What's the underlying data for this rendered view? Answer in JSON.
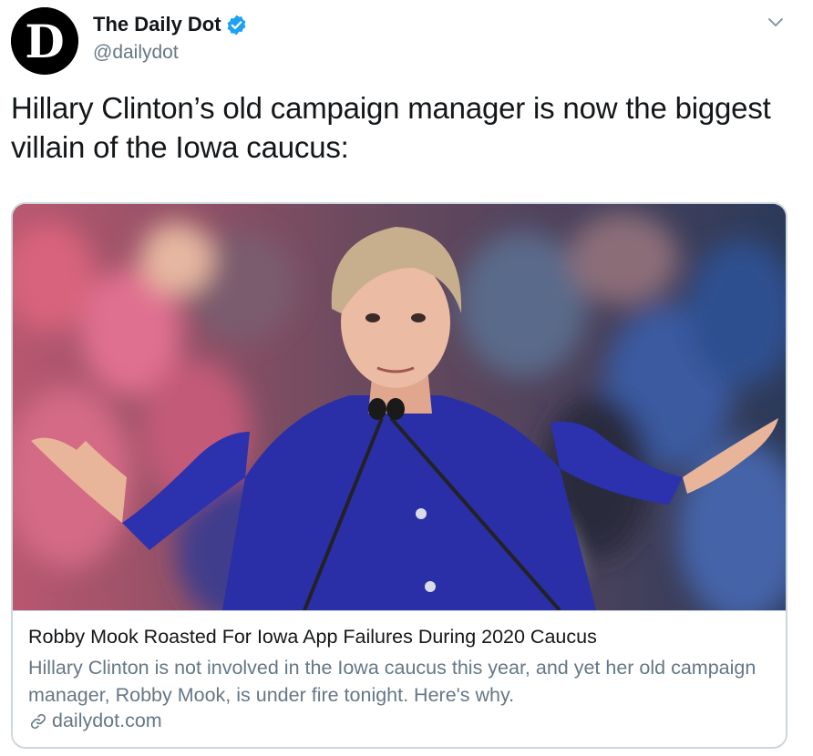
{
  "author": {
    "display_name": "The Daily Dot",
    "handle": "@dailydot",
    "avatar_letter": "D",
    "verified": true,
    "verified_color": "#1da1f2"
  },
  "tweet": {
    "text": "Hillary Clinton’s old campaign manager is now the biggest villain of the Iowa caucus:"
  },
  "card": {
    "image_icon": "photo-woman-at-podium",
    "title": "Robby Mook Roasted For Iowa App Failures During 2020 Caucus",
    "description": "Hillary Clinton is not involved in the Iowa caucus this year, and yet her old campaign manager, Robby Mook, is under fire tonight. Here's why.",
    "domain": "dailydot.com",
    "link_icon": "link-icon"
  },
  "icons": {
    "menu": "chevron-down-icon"
  },
  "colors": {
    "text": "#14171a",
    "secondary": "#657786",
    "border": "#ccd6dd",
    "blazer": "#2a2fa8"
  }
}
